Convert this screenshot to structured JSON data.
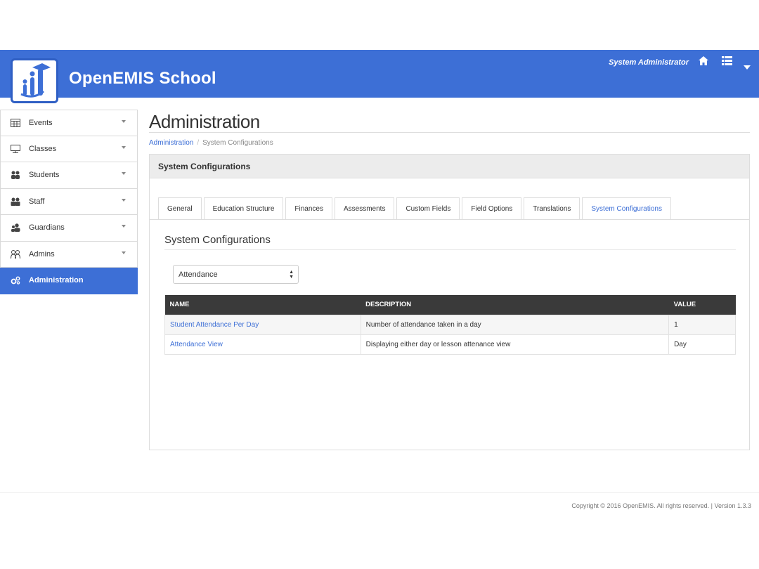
{
  "header": {
    "brand": "OpenEMIS School",
    "user": "System Administrator",
    "icons": [
      "home-icon",
      "list-icon",
      "caret-down-icon"
    ],
    "accent_color": "#3d6fd6"
  },
  "sidebar": {
    "items": [
      {
        "label": "Events",
        "icon": "calendar-icon"
      },
      {
        "label": "Classes",
        "icon": "classroom-icon"
      },
      {
        "label": "Students",
        "icon": "students-icon"
      },
      {
        "label": "Staff",
        "icon": "staff-icon"
      },
      {
        "label": "Guardians",
        "icon": "guardians-icon"
      },
      {
        "label": "Admins",
        "icon": "admins-icon"
      },
      {
        "label": "Administration",
        "icon": "gears-icon",
        "active": true
      }
    ]
  },
  "main": {
    "title": "Administration",
    "breadcrumb": {
      "root": "Administration",
      "current": "System Configurations"
    },
    "panel_title": "System Configurations",
    "tabs": [
      {
        "label": "General"
      },
      {
        "label": "Education Structure"
      },
      {
        "label": "Finances"
      },
      {
        "label": "Assessments"
      },
      {
        "label": "Custom Fields"
      },
      {
        "label": "Field Options"
      },
      {
        "label": "Translations"
      },
      {
        "label": "System Configurations",
        "active": true
      }
    ],
    "section_title": "System Configurations",
    "select_value": "Attendance",
    "table": {
      "headers": [
        "NAME",
        "DESCRIPTION",
        "VALUE"
      ],
      "rows": [
        [
          "Student Attendance Per Day",
          "Number of attendance taken in a day",
          "1"
        ],
        [
          "Attendance View",
          "Displaying either day or lesson attenance view",
          "Day"
        ]
      ]
    }
  },
  "footer": {
    "text": "Copyright © 2016 OpenEMIS. All rights reserved. | Version 1.3.3"
  }
}
